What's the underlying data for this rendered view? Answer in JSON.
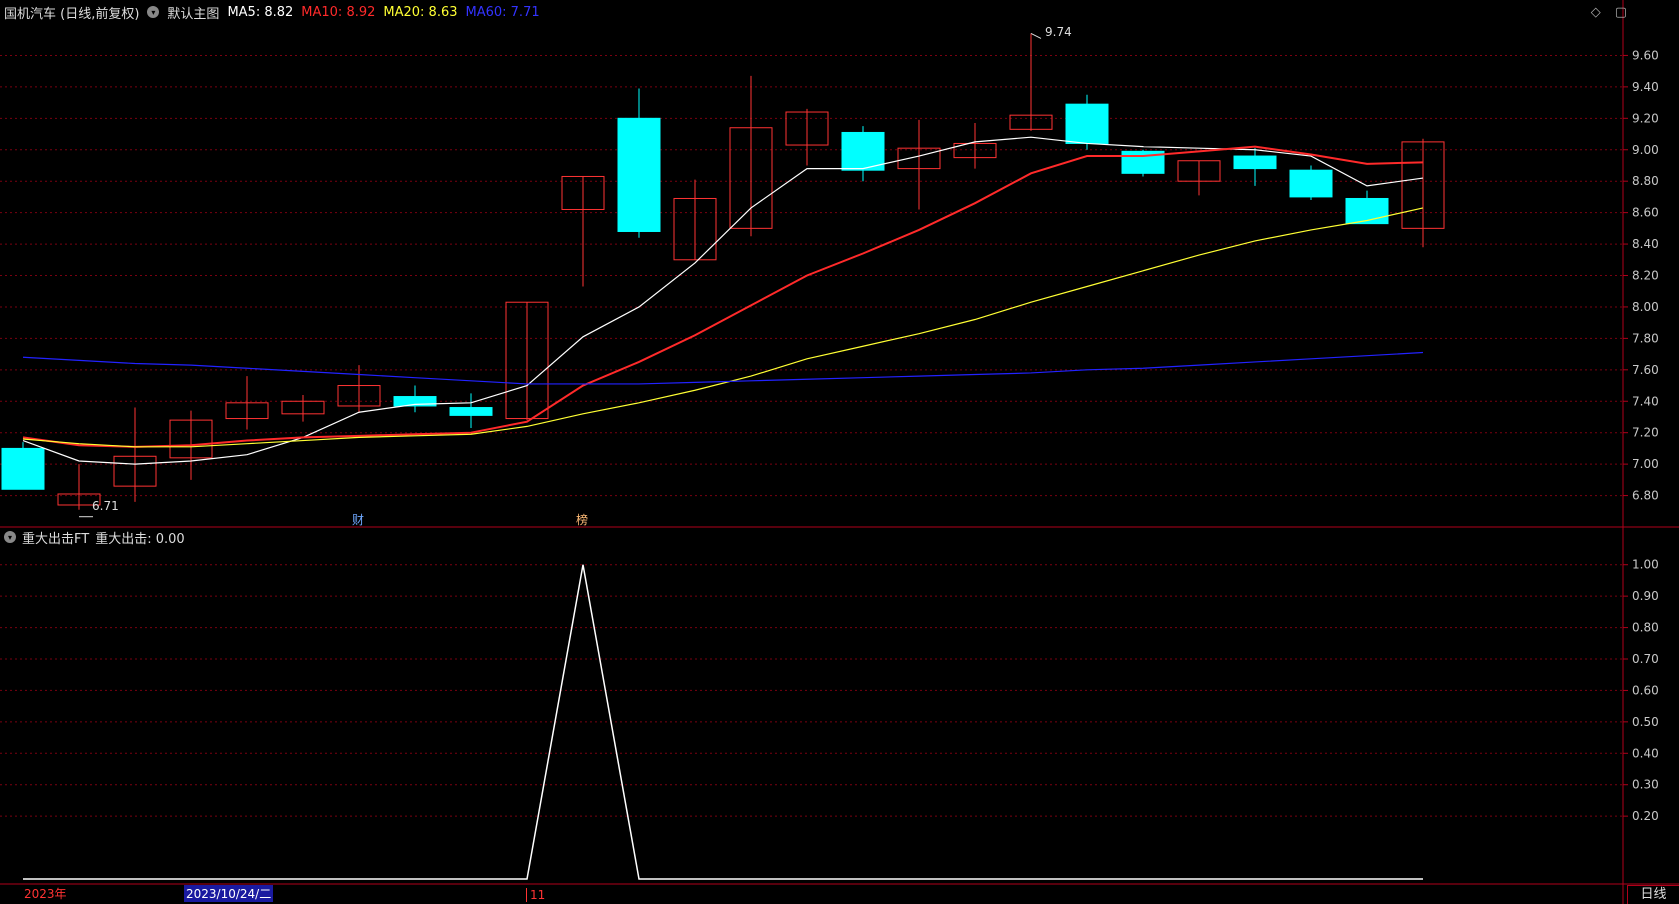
{
  "header": {
    "title": "国机汽车 (日线,前复权)",
    "indicator_name": "默认主图",
    "ma5": {
      "label": "MA5: 8.82",
      "color": "#ffffff"
    },
    "ma10": {
      "label": "MA10: 8.92",
      "color": "#ff2a2a"
    },
    "ma20": {
      "label": "MA20: 8.63",
      "color": "#ffff33"
    },
    "ma60": {
      "label": "MA60: 7.71",
      "color": "#2222ff"
    }
  },
  "subpanel": {
    "title": "重大出击FT",
    "value_label": "重大出击: 0.00"
  },
  "annotations": {
    "high_label": "9.74",
    "low_label": "6.71",
    "marker_cai": "财",
    "marker_bang": "榜"
  },
  "footer": {
    "year_label": "2023年",
    "cursor_date": "2023/10/24/二",
    "month_label": "11",
    "period_button": "日线"
  },
  "colors": {
    "up": "#ff3333",
    "down": "#00ffff",
    "grid": "#7a0010",
    "border": "#b0001a"
  },
  "chart_data": [
    {
      "type": "candlestick",
      "title": "国机汽车 (日线,前复权)",
      "ylim": [
        6.6,
        9.8
      ],
      "yticks": [
        "9.60",
        "9.40",
        "9.20",
        "9.00",
        "8.80",
        "8.60",
        "8.40",
        "8.20",
        "8.00",
        "7.80",
        "7.60",
        "7.40",
        "7.20",
        "7.00",
        "6.80"
      ],
      "candles": [
        {
          "o": 7.1,
          "h": 7.14,
          "l": 6.85,
          "c": 6.84
        },
        {
          "o": 6.74,
          "h": 7.0,
          "l": 6.71,
          "c": 6.81
        },
        {
          "o": 6.86,
          "h": 7.36,
          "l": 6.76,
          "c": 7.05
        },
        {
          "o": 7.04,
          "h": 7.34,
          "l": 6.9,
          "c": 7.28
        },
        {
          "o": 7.29,
          "h": 7.56,
          "l": 7.22,
          "c": 7.39
        },
        {
          "o": 7.32,
          "h": 7.44,
          "l": 7.27,
          "c": 7.4
        },
        {
          "o": 7.37,
          "h": 7.63,
          "l": 7.33,
          "c": 7.5
        },
        {
          "o": 7.43,
          "h": 7.5,
          "l": 7.33,
          "c": 7.37
        },
        {
          "o": 7.36,
          "h": 7.45,
          "l": 7.23,
          "c": 7.31
        },
        {
          "o": 7.29,
          "h": 8.03,
          "l": 7.28,
          "c": 8.03
        },
        {
          "o": 8.62,
          "h": 8.83,
          "l": 8.13,
          "c": 8.83
        },
        {
          "o": 9.2,
          "h": 9.39,
          "l": 8.44,
          "c": 8.48
        },
        {
          "o": 8.3,
          "h": 8.81,
          "l": 8.3,
          "c": 8.69
        },
        {
          "o": 8.5,
          "h": 9.47,
          "l": 8.45,
          "c": 9.14
        },
        {
          "o": 9.03,
          "h": 9.26,
          "l": 8.9,
          "c": 9.24
        },
        {
          "o": 9.11,
          "h": 9.15,
          "l": 8.8,
          "c": 8.87
        },
        {
          "o": 8.88,
          "h": 9.19,
          "l": 8.62,
          "c": 9.01
        },
        {
          "o": 8.95,
          "h": 9.17,
          "l": 8.88,
          "c": 9.04
        },
        {
          "o": 9.13,
          "h": 9.74,
          "l": 9.12,
          "c": 9.22
        },
        {
          "o": 9.29,
          "h": 9.35,
          "l": 9.0,
          "c": 9.04
        },
        {
          "o": 8.99,
          "h": 9.0,
          "l": 8.83,
          "c": 8.85
        },
        {
          "o": 8.8,
          "h": 8.93,
          "l": 8.71,
          "c": 8.93
        },
        {
          "o": 8.96,
          "h": 9.01,
          "l": 8.77,
          "c": 8.88
        },
        {
          "o": 8.87,
          "h": 8.9,
          "l": 8.68,
          "c": 8.7
        },
        {
          "o": 8.69,
          "h": 8.74,
          "l": 8.53,
          "c": 8.53
        },
        {
          "o": 8.5,
          "h": 9.07,
          "l": 8.38,
          "c": 9.05
        }
      ],
      "series": [
        {
          "name": "MA5",
          "color": "#ffffff",
          "values": [
            7.15,
            7.02,
            7.0,
            7.02,
            7.06,
            7.17,
            7.33,
            7.38,
            7.39,
            7.5,
            7.81,
            8.0,
            8.28,
            8.63,
            8.88,
            8.88,
            8.96,
            9.05,
            9.08,
            9.04,
            9.02,
            9.01,
            9.0,
            8.96,
            8.77,
            8.82
          ]
        },
        {
          "name": "MA10",
          "color": "#ff2a2a",
          "values": [
            7.17,
            7.12,
            7.11,
            7.12,
            7.15,
            7.17,
            7.18,
            7.19,
            7.2,
            7.27,
            7.5,
            7.65,
            7.82,
            8.01,
            8.2,
            8.34,
            8.49,
            8.66,
            8.85,
            8.96,
            8.96,
            8.99,
            9.02,
            8.97,
            8.91,
            8.92
          ]
        },
        {
          "name": "MA20",
          "color": "#ffff33",
          "values": [
            7.16,
            7.13,
            7.11,
            7.11,
            7.13,
            7.15,
            7.17,
            7.18,
            7.19,
            7.24,
            7.32,
            7.39,
            7.47,
            7.56,
            7.67,
            7.75,
            7.83,
            7.92,
            8.03,
            8.13,
            8.23,
            8.33,
            8.42,
            8.49,
            8.55,
            8.63
          ]
        },
        {
          "name": "MA60",
          "color": "#2222ff",
          "values": [
            7.68,
            7.66,
            7.64,
            7.63,
            7.61,
            7.59,
            7.57,
            7.55,
            7.53,
            7.51,
            7.51,
            7.51,
            7.52,
            7.53,
            7.54,
            7.55,
            7.56,
            7.57,
            7.58,
            7.6,
            7.61,
            7.63,
            7.65,
            7.67,
            7.69,
            7.71
          ]
        }
      ]
    },
    {
      "type": "line",
      "title": "重大出击FT",
      "ylim": [
        0,
        1.05
      ],
      "yticks": [
        "1.00",
        "0.90",
        "0.80",
        "0.70",
        "0.60",
        "0.50",
        "0.40",
        "0.30",
        "0.20"
      ],
      "series": [
        {
          "name": "重大出击",
          "color": "#ffffff",
          "values": [
            0,
            0,
            0,
            0,
            0,
            0,
            0,
            0,
            0,
            0,
            1,
            0,
            0,
            0,
            0,
            0,
            0,
            0,
            0,
            0,
            0,
            0,
            0,
            0,
            0,
            0
          ]
        }
      ]
    }
  ]
}
